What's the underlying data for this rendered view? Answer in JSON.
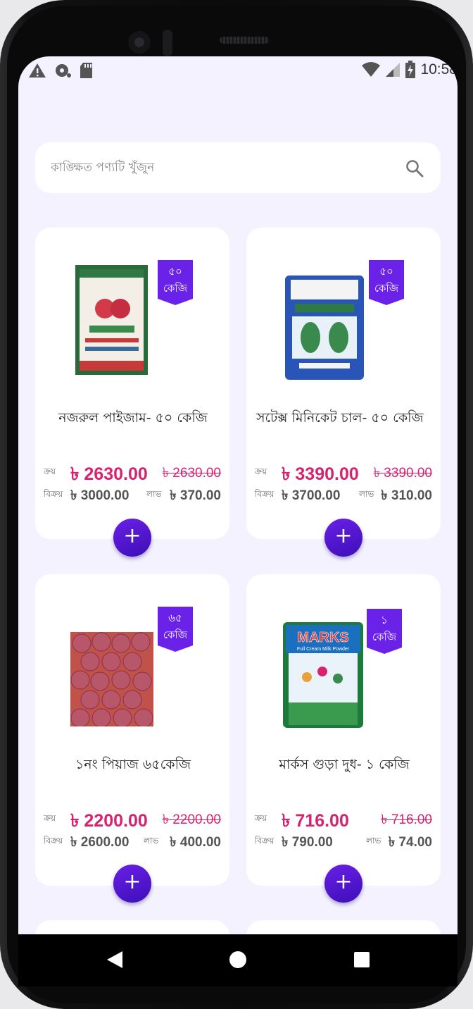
{
  "status_bar": {
    "time": "10:58"
  },
  "search": {
    "placeholder": "কাঙ্ক্ষিত পণ্যটি খুঁজুন"
  },
  "labels": {
    "buy": "ক্রয়",
    "sell": "বিক্রয়",
    "profit": "লাভ",
    "add": "+"
  },
  "products": [
    {
      "name": "নজরুল পাইজাম- ৫০ কেজি",
      "badge_qty": "৫০",
      "badge_unit": "কেজি",
      "buy_price": "৳ 2630.00",
      "old_price": "৳ 2630.00",
      "sell_price": "৳ 3000.00",
      "profit": "৳ 370.00"
    },
    {
      "name": "সটেক্স মিনিকেট চাল- ৫০ কেজি",
      "badge_qty": "৫০",
      "badge_unit": "কেজি",
      "buy_price": "৳ 3390.00",
      "old_price": "৳ 3390.00",
      "sell_price": "৳ 3700.00",
      "profit": "৳ 310.00"
    },
    {
      "name": "১নং পিয়াজ ৬৫কেজি",
      "badge_qty": "৬৫",
      "badge_unit": "কেজি",
      "buy_price": "৳ 2200.00",
      "old_price": "৳ 2200.00",
      "sell_price": "৳ 2600.00",
      "profit": "৳ 400.00"
    },
    {
      "name": "মার্কস গুড়া দুধ- ১ কেজি",
      "badge_qty": "১",
      "badge_unit": "কেজি",
      "buy_price": "৳ 716.00",
      "old_price": "৳ 716.00",
      "sell_price": "৳ 790.00",
      "profit": "৳ 74.00",
      "package_brand": "MARKS",
      "package_subtitle": "Full Cream Milk Powder"
    }
  ],
  "colors": {
    "accent": "#6a22e8",
    "price": "#d6236f",
    "background": "#f4f2ff"
  }
}
